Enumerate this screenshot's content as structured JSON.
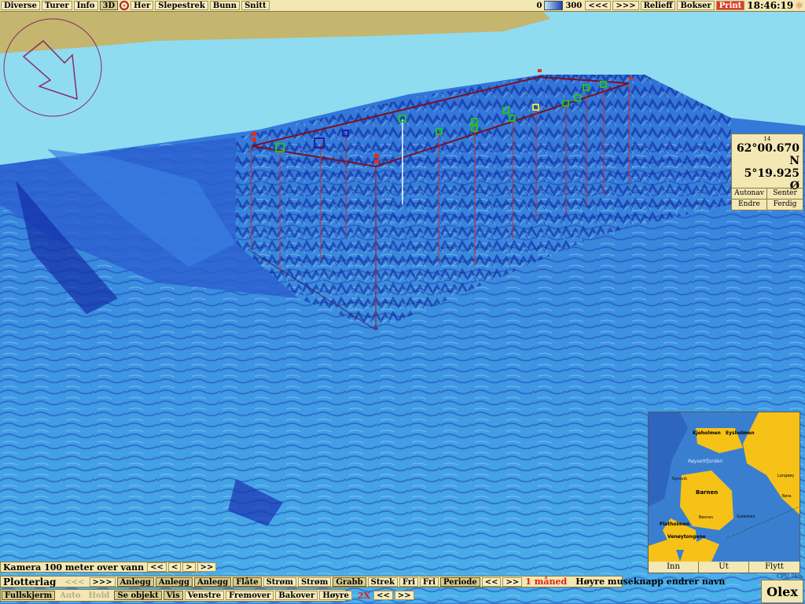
{
  "topbar": {
    "left": [
      "Diverse",
      "Turer",
      "Info",
      "3D",
      "Her",
      "Slepestrek",
      "Bunn",
      "Snitt"
    ],
    "depth_min": "0",
    "depth_max": "300",
    "right": [
      "<<<",
      ">>>",
      "Relieff",
      "Bokser",
      "Print"
    ],
    "time": "18:46:19"
  },
  "position": {
    "label": "14",
    "lat": "62°00.670 N",
    "lon": "5°19.925 Ø",
    "buttons": [
      "Autonav",
      "Senter",
      "Endre",
      "Ferdig"
    ]
  },
  "minimap": {
    "places": [
      "Kjeholmen",
      "Eysholmen",
      "Røysettfjorden",
      "Langeøy",
      "Børa",
      "Synsvik",
      "Barnen",
      "Bøsnes",
      "Gulestein",
      "Flatholmen",
      "Venøytongene"
    ],
    "buttons": [
      "Inn",
      "Ut",
      "Flytt"
    ]
  },
  "camera": {
    "text": "Kamera 100 meter over vann",
    "buttons": [
      "<<",
      "<",
      ">",
      ">>"
    ]
  },
  "plotterlag": {
    "label": "Plotterlag",
    "items": [
      "<<<",
      ">>>",
      "Anlegg",
      "Anlegg",
      "Anlegg",
      "Flåte",
      "Strøm",
      "Strøm",
      "Grabb",
      "Strek",
      "Fri",
      "Fri",
      "Periode",
      "<<",
      ">>"
    ],
    "period": "1 måned",
    "hint": "Høyre museknapp endrer navn"
  },
  "commands": {
    "items": [
      "Fullskjerm",
      "Auto",
      "Hold",
      "Se objekt",
      "Vis",
      "Venstre",
      "Fremover",
      "Bakover",
      "Høyre"
    ],
    "speed": "2X",
    "nav": [
      "<<",
      ">>"
    ]
  },
  "brand": "Olex",
  "cpu": "CPU 76%",
  "colors": {
    "panel": "#f3e7b4",
    "land": "#c4b56f",
    "shallow": "#8fdcf0",
    "sea": "#3a78d8",
    "deep": "#1a3ab0",
    "marker_green": "#22c022",
    "line_red": "#b02020"
  }
}
